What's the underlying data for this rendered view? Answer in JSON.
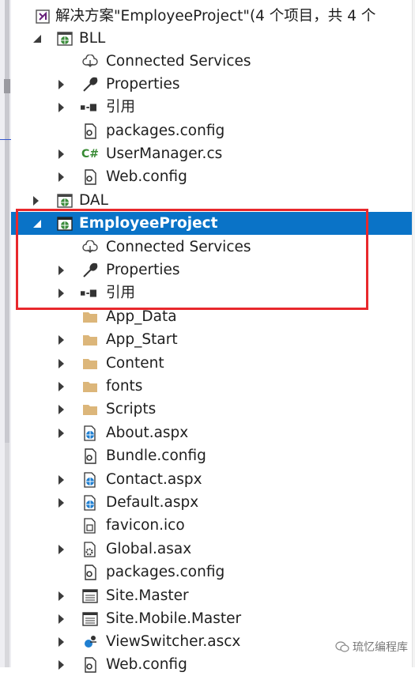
{
  "solution": {
    "label": "解决方案\"EmployeeProject\"(4 个项目，共 4 个"
  },
  "projects": {
    "bll": {
      "label": "BLL",
      "items": [
        "Connected Services",
        "Properties",
        "引用",
        "packages.config",
        "UserManager.cs",
        "Web.config"
      ]
    },
    "dal": {
      "label": "DAL"
    },
    "employee": {
      "label": "EmployeeProject",
      "items": [
        "Connected Services",
        "Properties",
        "引用",
        "App_Data",
        "App_Start",
        "Content",
        "fonts",
        "Scripts",
        "About.aspx",
        "Bundle.config",
        "Contact.aspx",
        "Default.aspx",
        "favicon.ico",
        "Global.asax",
        "packages.config",
        "Site.Master",
        "Site.Mobile.Master",
        "ViewSwitcher.ascx",
        "Web.config"
      ]
    }
  },
  "watermark": "琉忆编程库",
  "colors": {
    "selection": "#0a73c7",
    "highlight": "#e8282c",
    "folder": "#dcb67a",
    "web": "#1f7fd1"
  }
}
